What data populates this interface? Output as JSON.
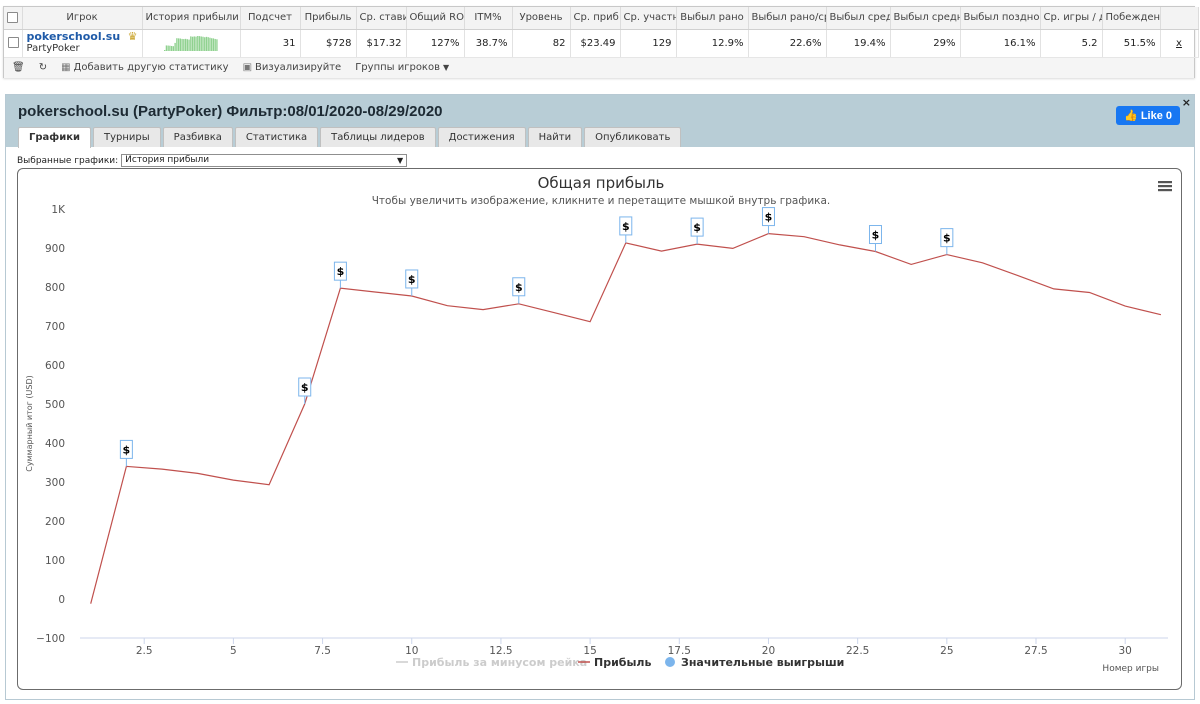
{
  "stats_table": {
    "columns": [
      "Игрок",
      "История прибыли",
      "Подсчет",
      "Прибыль",
      "Ср. стави",
      "Общий ROI",
      "ITM%",
      "Уровень",
      "Ср. приб",
      "Ср. участн",
      "Выбыл рано",
      "Выбыл рано/ср",
      "Выбыл сред",
      "Выбыл средн",
      "Выбыл поздно",
      "Ср. игры / д",
      "Побежденн"
    ],
    "row": {
      "player": "pokerschool.su",
      "site": "PartyPoker",
      "medal_icon": "medal-icon",
      "values": [
        "31",
        "$728",
        "$17.32",
        "127%",
        "38.7%",
        "82",
        "$23.49",
        "129",
        "12.9%",
        "22.6%",
        "19.4%",
        "29%",
        "16.1%",
        "5.2",
        "51.5%"
      ],
      "close_label": "x"
    },
    "toolbar": {
      "add_stats": "Добавить другую статистику",
      "visualize": "Визуализируйте",
      "groups": "Группы игроков"
    }
  },
  "panel": {
    "title": "pokerschool.su (PartyPoker) Фильтр:08/01/2020-08/29/2020",
    "like_label": "Like 0",
    "close_label": "×",
    "tabs": [
      "Графики",
      "Турниры",
      "Разбивка",
      "Статистика",
      "Таблицы лидеров",
      "Достижения",
      "Найти",
      "Опубликовать"
    ],
    "active_tab": 0,
    "select_label": "Выбранные графики:",
    "select_value": "История прибыли"
  },
  "chart_data": {
    "type": "line",
    "title": "Общая прибыль",
    "subtitle": "Чтобы увеличить изображение, кликните и перетащите мышкой внутрь графика.",
    "xlabel": "Номер игры",
    "ylabel": "Суммарный итог (USD)",
    "xlim": [
      0.7,
      31.2
    ],
    "ylim": [
      -100,
      1000
    ],
    "x_ticks": [
      "2.5",
      "5",
      "7.5",
      "10",
      "12.5",
      "15",
      "17.5",
      "20",
      "22.5",
      "25",
      "27.5",
      "30"
    ],
    "x_tick_values": [
      2.5,
      5,
      7.5,
      10,
      12.5,
      15,
      17.5,
      20,
      22.5,
      25,
      27.5,
      30
    ],
    "y_ticks": [
      "1K",
      "900",
      "800",
      "700",
      "600",
      "500",
      "400",
      "300",
      "200",
      "100",
      "0",
      "−100"
    ],
    "y_tick_values": [
      1000,
      900,
      800,
      700,
      600,
      500,
      400,
      300,
      200,
      100,
      0,
      -100
    ],
    "series": [
      {
        "name": "Прибыль",
        "color": "#c0504d",
        "x": [
          1,
          2,
          3,
          4,
          5,
          6,
          7,
          8,
          9,
          10,
          11,
          12,
          13,
          14,
          15,
          16,
          17,
          18,
          19,
          20,
          21,
          22,
          23,
          24,
          25,
          26,
          27,
          28,
          29,
          30,
          31
        ],
        "values": [
          -12,
          340,
          333,
          322,
          305,
          293,
          500,
          797,
          787,
          777,
          752,
          742,
          757,
          734,
          711,
          913,
          892,
          910,
          899,
          937,
          929,
          908,
          891,
          858,
          883,
          862,
          829,
          795,
          786,
          751,
          729
        ]
      }
    ],
    "big_win_markers": {
      "label": "$",
      "x": [
        2,
        7,
        8,
        10,
        13,
        16,
        18,
        20,
        23,
        25
      ]
    },
    "legend": [
      {
        "name": "Прибыль за минусом рейка",
        "color": "#cccccc",
        "shape": "line",
        "muted": true
      },
      {
        "name": "Прибыль",
        "color": "#c0504d",
        "shape": "line",
        "muted": false
      },
      {
        "name": "Значительные выигрыши",
        "color": "#7cb5ec",
        "shape": "circle",
        "muted": false
      }
    ],
    "legend_position": "bottom-center",
    "grid": false,
    "menu_icon": "hamburger-menu-icon"
  }
}
